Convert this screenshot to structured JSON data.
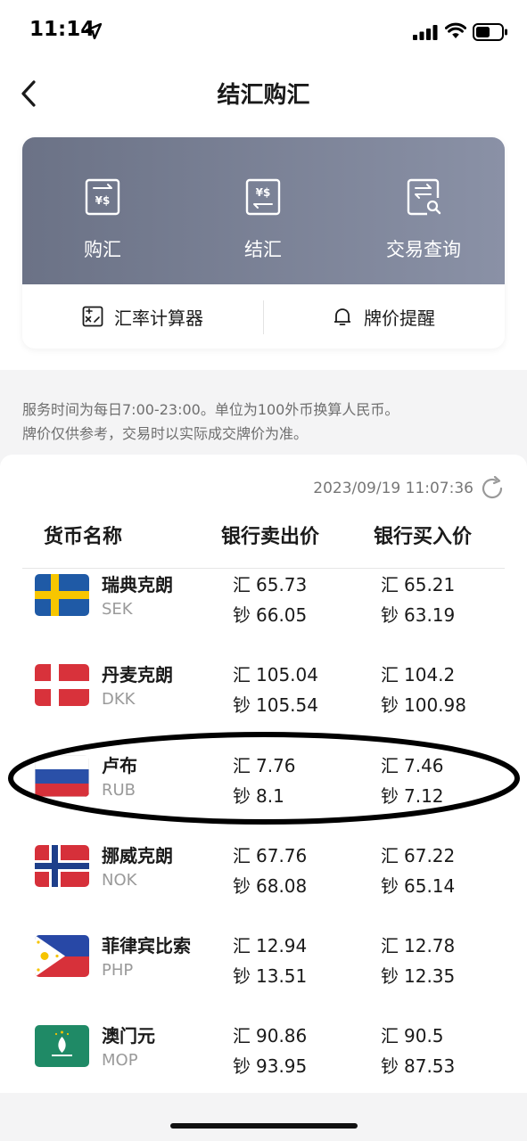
{
  "status_bar": {
    "time": "11:14"
  },
  "nav": {
    "title": "结汇购汇"
  },
  "actions": [
    {
      "label": "购汇",
      "icon": "buy-fx-icon"
    },
    {
      "label": "结汇",
      "icon": "sell-fx-icon"
    },
    {
      "label": "交易查询",
      "icon": "transaction-query-icon"
    }
  ],
  "tools": [
    {
      "label": "汇率计算器",
      "icon": "calculator-icon"
    },
    {
      "label": "牌价提醒",
      "icon": "bell-icon"
    }
  ],
  "notice": {
    "line1": "服务时间为每日7:00-23:00。单位为100外币换算人民币。",
    "line2": "牌价仅供参考，交易时以实际成交牌价为准。"
  },
  "table": {
    "timestamp": "2023/09/19 11:07:36",
    "headers": [
      "货币名称",
      "银行卖出价",
      "银行买入价"
    ],
    "prefix_hui": "汇",
    "prefix_chao": "钞",
    "rows": [
      {
        "name": "瑞典克朗",
        "code": "SEK",
        "sell_hui": "65.73",
        "sell_chao": "66.05",
        "buy_hui": "65.21",
        "buy_chao": "63.19"
      },
      {
        "name": "丹麦克朗",
        "code": "DKK",
        "sell_hui": "105.04",
        "sell_chao": "105.54",
        "buy_hui": "104.2",
        "buy_chao": "100.98"
      },
      {
        "name": "卢布",
        "code": "RUB",
        "sell_hui": "7.76",
        "sell_chao": "8.1",
        "buy_hui": "7.46",
        "buy_chao": "7.12"
      },
      {
        "name": "挪威克朗",
        "code": "NOK",
        "sell_hui": "67.76",
        "sell_chao": "68.08",
        "buy_hui": "67.22",
        "buy_chao": "65.14"
      },
      {
        "name": "菲律宾比索",
        "code": "PHP",
        "sell_hui": "12.94",
        "sell_chao": "13.51",
        "buy_hui": "12.78",
        "buy_chao": "12.35"
      },
      {
        "name": "澳门元",
        "code": "MOP",
        "sell_hui": "90.86",
        "sell_chao": "93.95",
        "buy_hui": "90.5",
        "buy_chao": "87.53"
      }
    ]
  },
  "colors": {
    "card_gradient_start": "#6b7286",
    "card_gradient_end": "#8a91a6",
    "annotation": "#000000"
  }
}
